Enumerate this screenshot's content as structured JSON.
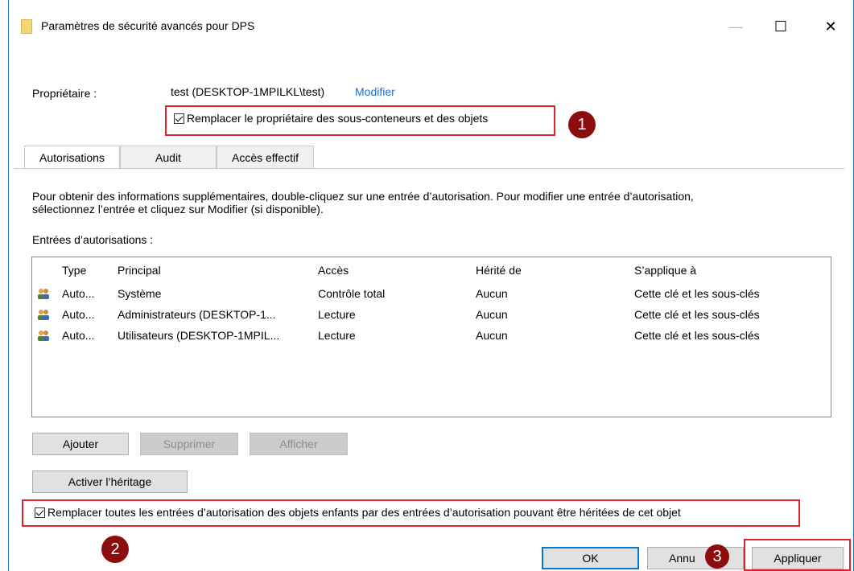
{
  "window": {
    "title": "Paramètres de sécurité avancés pour DPS",
    "minimize": "—",
    "maximize": "☐",
    "close": "✕"
  },
  "owner": {
    "label": "Propriétaire :",
    "value": "test (DESKTOP-1MPILKL\\test)",
    "change_link": "Modifier",
    "replace_owner_checkbox": "Remplacer le propriétaire des sous-conteneurs et des objets",
    "replace_owner_checked": true
  },
  "tabs": [
    "Autorisations",
    "Audit",
    "Accès effectif"
  ],
  "info_text_line1": "Pour obtenir des informations supplémentaires, double-cliquez sur une entrée d’autorisation. Pour modifier une entrée d’autorisation,",
  "info_text_line2": "sélectionnez l’entrée et cliquez sur Modifier (si disponible).",
  "entries_label": "Entrées d’autorisations :",
  "table": {
    "columns": [
      "Type",
      "Principal",
      "Accès",
      "Hérité de",
      "S’applique à"
    ],
    "rows": [
      [
        "Auto...",
        "Système",
        "Contrôle total",
        "Aucun",
        "Cette clé et les sous-clés"
      ],
      [
        "Auto...",
        "Administrateurs (DESKTOP-1...",
        "Lecture",
        "Aucun",
        "Cette clé et les sous-clés"
      ],
      [
        "Auto...",
        "Utilisateurs (DESKTOP-1MPIL...",
        "Lecture",
        "Aucun",
        "Cette clé et les sous-clés"
      ]
    ]
  },
  "buttons": {
    "add": "Ajouter",
    "remove": "Supprimer",
    "view": "Afficher",
    "enable_inheritance": "Activer l’héritage",
    "ok": "OK",
    "cancel": "Annu",
    "apply": "Appliquer"
  },
  "replace_child_checkbox": "Remplacer toutes les entrées d’autorisation des objets enfants par des entrées d’autorisation pouvant être héritées de cet objet",
  "replace_child_checked": true,
  "annotations": [
    "1",
    "2",
    "3"
  ],
  "colors": {
    "highlight": "#e0232b",
    "badge": "#8b0d0d",
    "link": "#1a6fd6",
    "accent": "#0078d7"
  }
}
